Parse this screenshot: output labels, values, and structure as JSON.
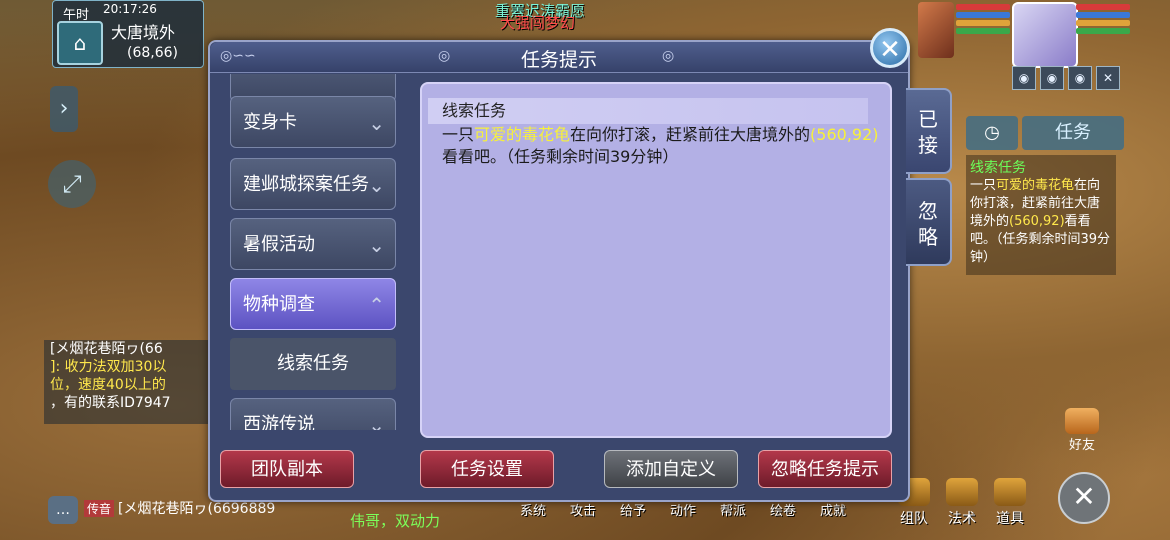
{
  "hud": {
    "time_label": "午时",
    "clock": "20:17:26",
    "map_name": "大唐境外",
    "coords": "(68,66)"
  },
  "event": {
    "line1": "重罴迟涛霸愿",
    "line2": "大强闯梦幻"
  },
  "dialog": {
    "title": "任务提示",
    "categories": [
      {
        "label": "变身卡",
        "state": "collapsed"
      },
      {
        "label": "建邺城探案任务",
        "state": "collapsed"
      },
      {
        "label": "暑假活动",
        "state": "collapsed"
      },
      {
        "label": "物种调查",
        "state": "expanded"
      }
    ],
    "subcategory": "线索任务",
    "next_category": "西游传说",
    "content": {
      "heading": "线索任务",
      "text_pre": "一只",
      "highlight_name": "可爱的毒花龟",
      "text_mid": "在向你打滚，赶紧前往大唐境外的",
      "highlight_coord": "(560,92)",
      "text_post": "看看吧。（任务剩余时间39分钟）"
    },
    "side_tabs": [
      {
        "label": "已接",
        "active": true
      },
      {
        "label": "忽略",
        "active": false
      }
    ],
    "buttons": {
      "team_dungeon": "团队副本",
      "task_settings": "任务设置",
      "add_custom": "添加自定义",
      "ignore_hint": "忽略任务提示"
    }
  },
  "tracker": {
    "tab_task": "任务",
    "title": "线索任务",
    "pre": "一只",
    "name": "可爱的毒花龟",
    "mid": "在向你打滚，赶紧前往大唐境外的",
    "coord": "(560,92)",
    "post": "看看吧。（任务剩余时间39分钟）"
  },
  "chat": {
    "lines": [
      "[メ烟花巷陌ヮ(66",
      "]: 收力法双加30以",
      "位，速度40以上的",
      "，有的联系ID7947"
    ],
    "bottom_tag": "传音",
    "bottom_line": "[メ烟花巷陌ヮ(6696889",
    "green_text": "伟哥，双动力"
  },
  "bottom_menu": [
    "系统",
    "攻击",
    "给予",
    "动作",
    "帮派",
    "绘卷",
    "成就"
  ],
  "right_menu": [
    "组队",
    "法术",
    "道具"
  ],
  "friends_label": "好友",
  "colors": {
    "dialog_bg": "#3b476d",
    "content_bg": "#b3b0e5",
    "highlight": "#f7f13a",
    "active_tab": "#7b72da",
    "danger_button": "#8e2535"
  }
}
